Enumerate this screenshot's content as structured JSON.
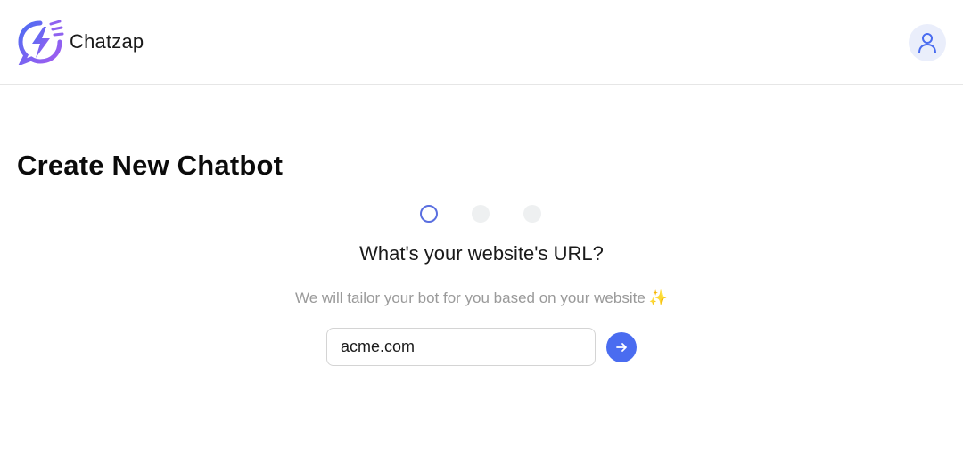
{
  "header": {
    "brand_name": "Chatzap",
    "logo_icon": "lightning-chat-logo-icon",
    "user_icon": "user-icon"
  },
  "page": {
    "title": "Create New Chatbot"
  },
  "stepper": {
    "total_steps": 3,
    "current_step": 1
  },
  "form": {
    "question": "What's your website's URL?",
    "subtitle": "We will tailor your bot for you based on your website",
    "subtitle_emoji": "✨",
    "url_value": "acme.com",
    "submit_icon": "arrow-right-icon"
  },
  "colors": {
    "accent": "#4a6cf0",
    "step_active_border": "#5a6fe0",
    "step_inactive": "#eef0f1",
    "avatar_bg": "#eaeefb",
    "subtitle_text": "#9a9a9a"
  }
}
